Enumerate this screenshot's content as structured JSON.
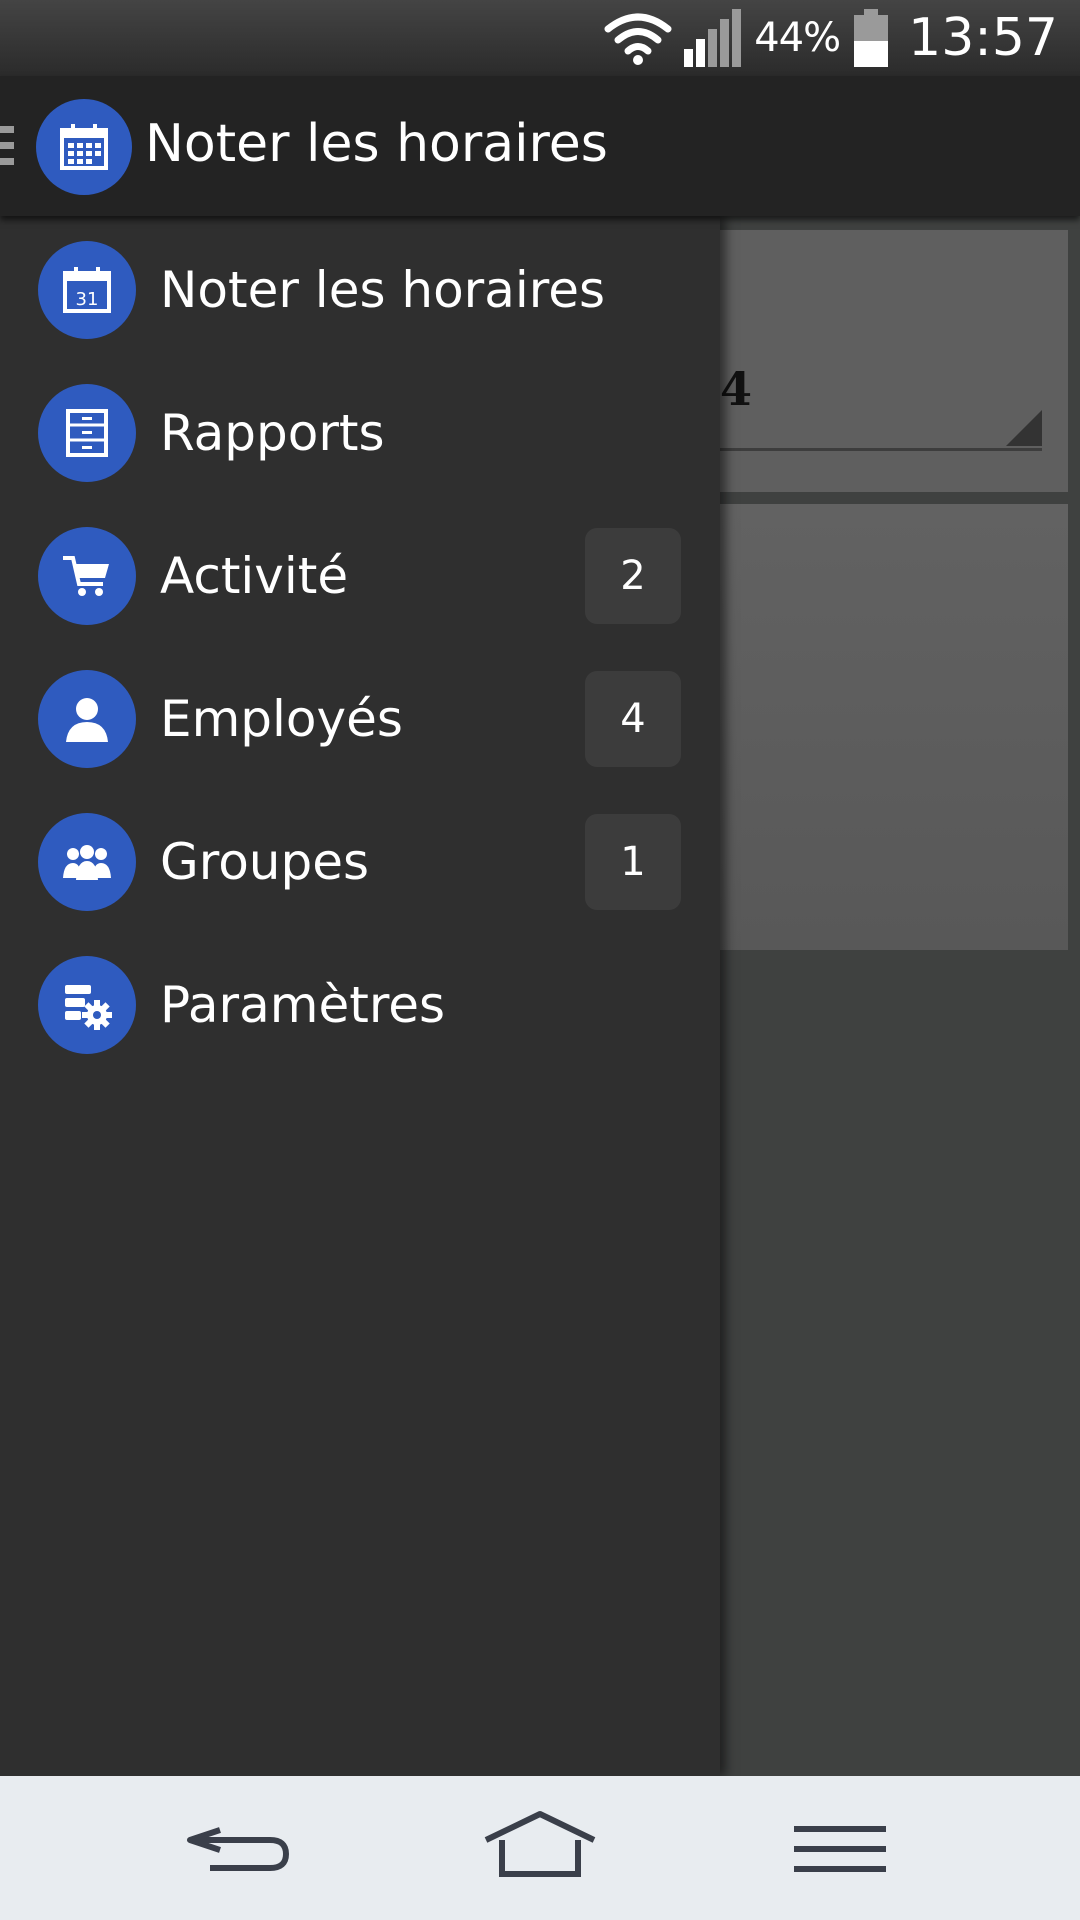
{
  "status_bar": {
    "battery_percent": "44%",
    "time": "13:57"
  },
  "action_bar": {
    "title": "Noter les horaires",
    "app_icon": "calendar-icon"
  },
  "drawer": {
    "items": [
      {
        "label": "Noter les horaires",
        "icon": "calendar-31-icon",
        "badge": null
      },
      {
        "label": "Rapports",
        "icon": "cabinet-icon",
        "badge": null
      },
      {
        "label": "Activité",
        "icon": "cart-icon",
        "badge": "2"
      },
      {
        "label": "Employés",
        "icon": "person-icon",
        "badge": "4"
      },
      {
        "label": "Groupes",
        "icon": "group-icon",
        "badge": "1"
      },
      {
        "label": "Paramètres",
        "icon": "settings-icon",
        "badge": null
      }
    ]
  },
  "background": {
    "partial_value": "4"
  },
  "colors": {
    "accent": "#2f5bbf",
    "drawer_bg": "#2f2f2f",
    "actionbar_bg": "#232323",
    "badge_bg": "#3c3c3c",
    "navbar_bg": "#e8ecf0"
  }
}
